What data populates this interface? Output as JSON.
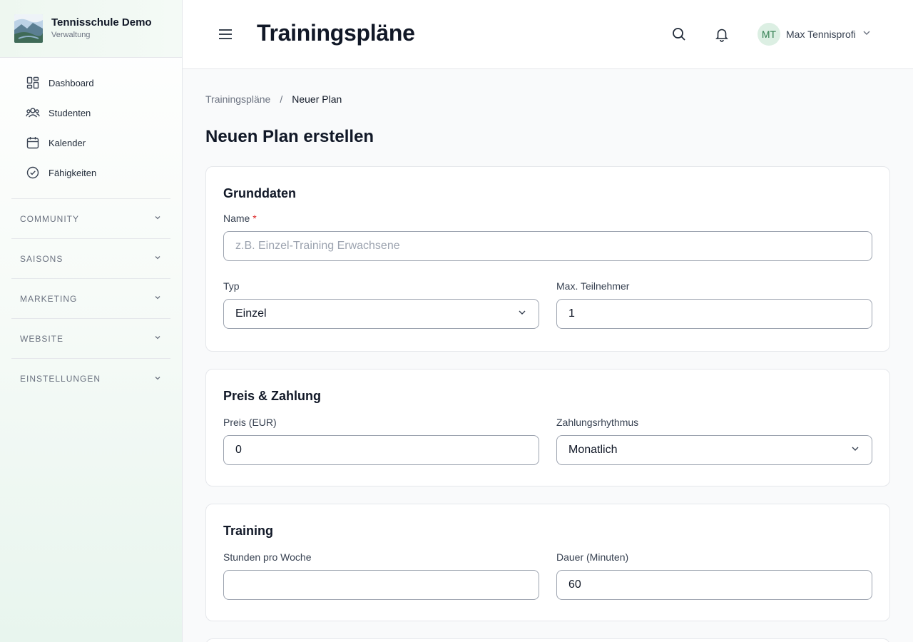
{
  "brand": {
    "name": "Tennisschule Demo",
    "subtitle": "Verwaltung"
  },
  "nav": [
    {
      "label": "Dashboard",
      "icon": "dashboard-icon"
    },
    {
      "label": "Studenten",
      "icon": "users-icon"
    },
    {
      "label": "Kalender",
      "icon": "calendar-icon"
    },
    {
      "label": "Fähigkeiten",
      "icon": "check-circle-icon"
    }
  ],
  "sections": [
    {
      "label": "COMMUNITY"
    },
    {
      "label": "SAISONS"
    },
    {
      "label": "MARKETING"
    },
    {
      "label": "WEBSITE"
    },
    {
      "label": "EINSTELLUNGEN"
    }
  ],
  "header": {
    "title": "Trainingspläne",
    "user": {
      "initials": "MT",
      "name": "Max Tennisprofi"
    }
  },
  "breadcrumb": {
    "parent": "Trainingspläne",
    "separator": "/",
    "current": "Neuer Plan"
  },
  "page": {
    "heading": "Neuen Plan erstellen"
  },
  "form": {
    "basics": {
      "title": "Grunddaten",
      "name_label": "Name",
      "required_mark": "*",
      "name_placeholder": "z.B. Einzel-Training Erwachsene",
      "type_label": "Typ",
      "type_value": "Einzel",
      "max_label": "Max. Teilnehmer",
      "max_value": "1"
    },
    "payment": {
      "title": "Preis & Zahlung",
      "price_label": "Preis (EUR)",
      "price_value": "0",
      "rhythm_label": "Zahlungsrhythmus",
      "rhythm_value": "Monatlich"
    },
    "training": {
      "title": "Training",
      "hours_label": "Stunden pro Woche",
      "hours_value": "",
      "duration_label": "Dauer (Minuten)",
      "duration_value": "60"
    }
  },
  "colors": {
    "accent": "#2f7d4e",
    "required": "#dc2626",
    "border": "#e5e7eb"
  }
}
